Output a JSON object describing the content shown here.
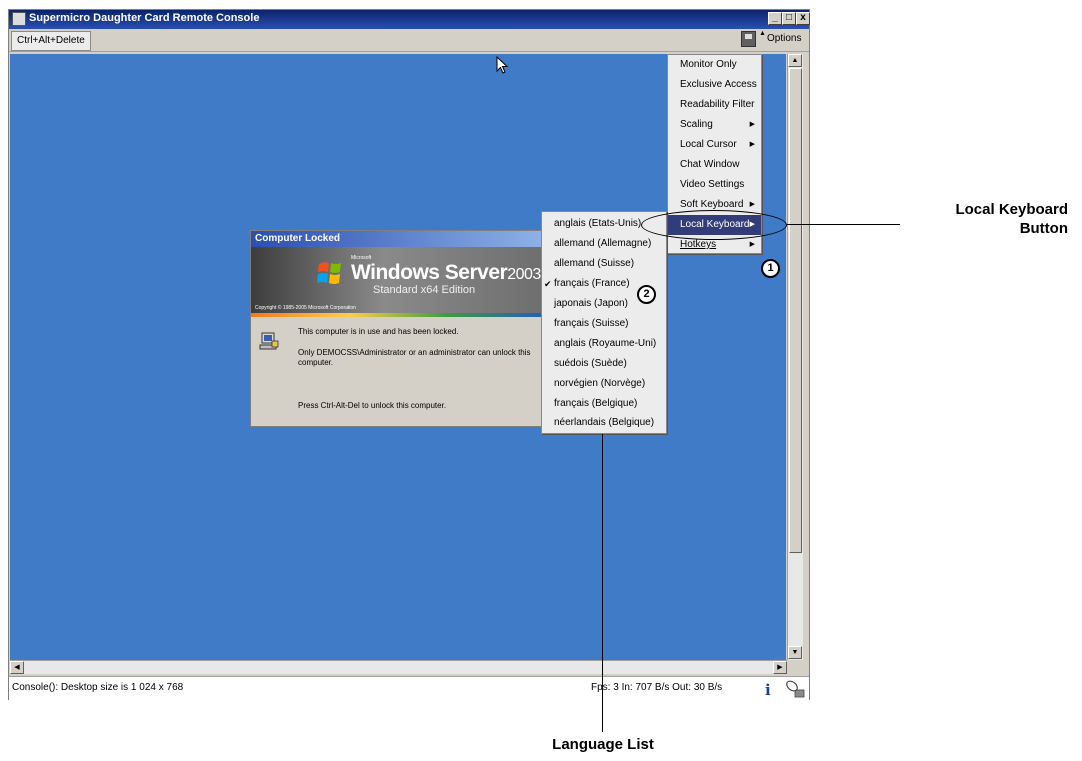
{
  "window": {
    "title": "Supermicro Daughter Card Remote Console",
    "title_buttons": [
      "_",
      "□",
      "x"
    ]
  },
  "toolbar": {
    "ctrl_alt_delete_label": "Ctrl+Alt+Delete",
    "options_label": "Options",
    "save_icon": "floppy-disk-icon"
  },
  "locked_dialog": {
    "title": "Computer Locked",
    "brand_small": "Microsoft",
    "product_name": "Windows Server",
    "product_year": "2003",
    "edition": "Standard x64 Edition",
    "copyright": "Copyright © 1985-2005 Microsoft Corporation",
    "message_1": "This computer is in use and has been locked.",
    "message_2": "Only DEMOCSS\\Administrator or an administrator can unlock this computer.",
    "message_3": "Press Ctrl-Alt-Del to unlock this computer."
  },
  "options_menu": {
    "items": [
      {
        "label": "Monitor Only",
        "submenu": false
      },
      {
        "label": "Exclusive Access",
        "submenu": false
      },
      {
        "label": "Readability Filter",
        "submenu": false
      },
      {
        "label": "Scaling",
        "submenu": true
      },
      {
        "label": "Local Cursor",
        "submenu": true
      },
      {
        "label": "Chat Window",
        "submenu": false
      },
      {
        "label": "Video Settings",
        "submenu": false
      },
      {
        "label": "Soft Keyboard",
        "submenu": true
      },
      {
        "label": "Local Keyboard",
        "submenu": true,
        "highlighted": true
      },
      {
        "label": "Hotkeys",
        "submenu": true
      }
    ]
  },
  "language_menu": {
    "items": [
      {
        "label": "anglais (Etats-Unis)",
        "checked": false
      },
      {
        "label": "allemand (Allemagne)",
        "checked": false
      },
      {
        "label": "allemand (Suisse)",
        "checked": false
      },
      {
        "label": "français (France)",
        "checked": true
      },
      {
        "label": "japonais (Japon)",
        "checked": false
      },
      {
        "label": "français (Suisse)",
        "checked": false
      },
      {
        "label": "anglais (Royaume-Uni)",
        "checked": false
      },
      {
        "label": "suédois (Suède)",
        "checked": false
      },
      {
        "label": "norvégien (Norvège)",
        "checked": false
      },
      {
        "label": "français (Belgique)",
        "checked": false
      },
      {
        "label": "néerlandais (Belgique)",
        "checked": false
      }
    ]
  },
  "status_bar": {
    "left_text": "Console(): Desktop size is 1 024 x 768",
    "right_text": "Fps: 3 In: 707 B/s Out: 30 B/s"
  },
  "annotations": {
    "marker_1": "1",
    "marker_2": "2",
    "local_keyboard_line1": "Local Keyboard",
    "local_keyboard_line2": "Button",
    "language_list": "Language List"
  },
  "colors": {
    "desktop": "#3f7bc6",
    "titlebar": "#0a246a",
    "menu_highlight": "#323c78"
  }
}
